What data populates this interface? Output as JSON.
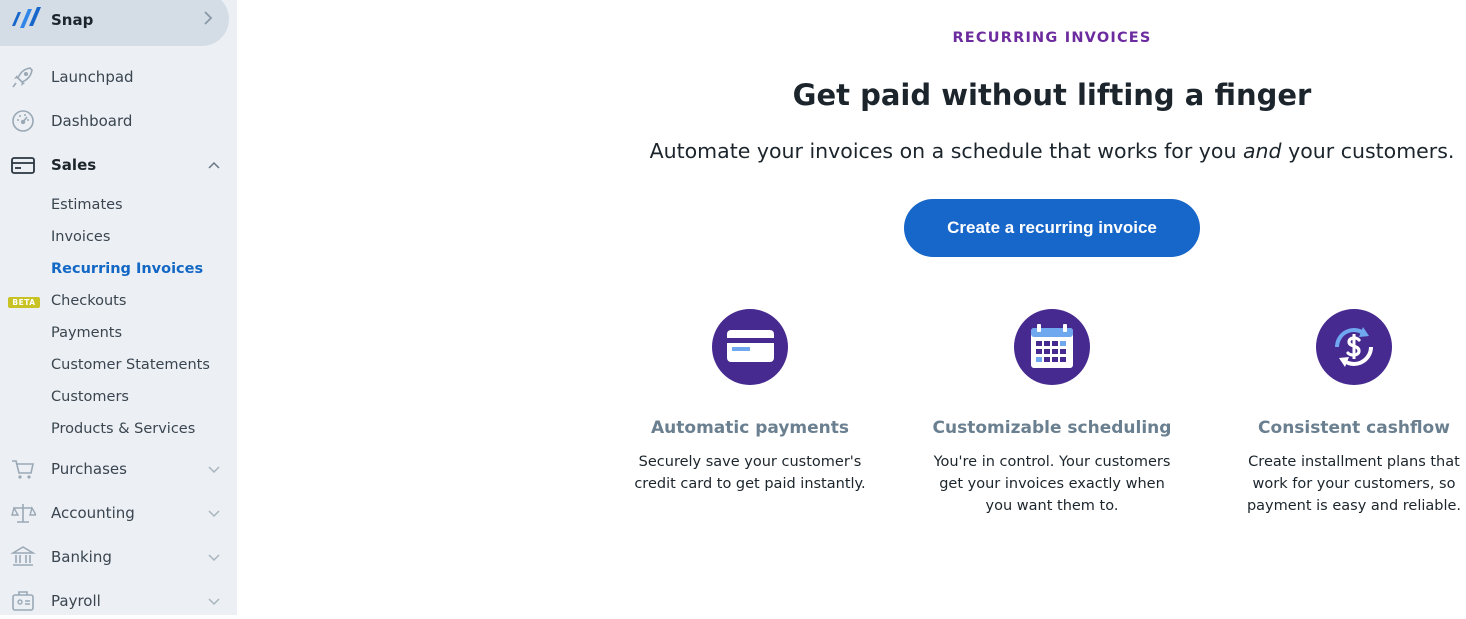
{
  "sidebar": {
    "business_name": "Snap",
    "nav": [
      {
        "label": "Launchpad",
        "icon": "rocket-icon"
      },
      {
        "label": "Dashboard",
        "icon": "gauge-icon"
      },
      {
        "label": "Sales",
        "icon": "card-icon",
        "expanded": true
      },
      {
        "label": "Purchases",
        "icon": "cart-icon"
      },
      {
        "label": "Accounting",
        "icon": "scale-icon"
      },
      {
        "label": "Banking",
        "icon": "bank-icon"
      },
      {
        "label": "Payroll",
        "icon": "payroll-icon"
      }
    ],
    "sales_items": [
      {
        "label": "Estimates"
      },
      {
        "label": "Invoices"
      },
      {
        "label": "Recurring Invoices",
        "active": true
      },
      {
        "label": "Checkouts",
        "badge": "BETA"
      },
      {
        "label": "Payments"
      },
      {
        "label": "Customer Statements"
      },
      {
        "label": "Customers"
      },
      {
        "label": "Products & Services"
      }
    ]
  },
  "main": {
    "eyebrow": "RECURRING INVOICES",
    "headline": "Get paid without lifting a finger",
    "subhead_before": "Automate your invoices on a schedule that works for you ",
    "subhead_em": "and",
    "subhead_after": " your customers.",
    "cta_label": "Create a recurring invoice",
    "features": [
      {
        "title": "Automatic payments",
        "description": "Securely save your customer's credit card to get paid instantly.",
        "icon": "credit-card-icon"
      },
      {
        "title": "Customizable scheduling",
        "description": "You're in control. Your customers get your invoices exactly when you want them to.",
        "icon": "calendar-icon"
      },
      {
        "title": "Consistent cashflow",
        "description": "Create installment plans that work for your customers, so payment is easy and reliable.",
        "icon": "dollar-cycle-icon"
      }
    ]
  },
  "colors": {
    "sidebar_bg": "#ecf0f4",
    "active_link": "#1367c5",
    "eyebrow": "#6c2b9e",
    "cta": "#1766c9",
    "icon_circle": "#472a90",
    "beta_badge": "#c8c224"
  }
}
